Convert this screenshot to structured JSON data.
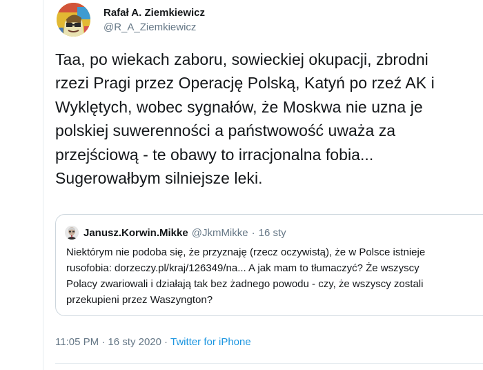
{
  "tweet": {
    "author": {
      "display_name": "Rafał A. Ziemkiewicz",
      "handle": "@R_A_Ziemkiewicz",
      "avatar_icon": "profile-avatar"
    },
    "text": "Taa, po wiekach zaboru, sowieckiej okupacji, zbrodni\nrzezi Pragi przez Operację Polską, Katyń po rzeź AK i\nWyklętych, wobec sygnałów, że Moskwa nie uzna je\npolskiej suwerenności a państwowość uważa za\nprzejściową - te obawy to irracjonalna fobia...\nSugerowałbym silniejsze leki.",
    "timestamp": "11:05 PM · 16 sty 2020",
    "separator": "·",
    "source": "Twitter for iPhone"
  },
  "quoted_tweet": {
    "display_name": "Janusz.Korwin.Mikke",
    "handle": "@JkmMikke",
    "separator": "·",
    "date": "16 sty",
    "avatar_icon": "profile-avatar",
    "text": "Niektórym nie podoba się, że przyznaję (rzecz oczywistą), że w Polsce istnieje\nrusofobia: dorzeczy.pl/kraj/126349/na... A jak mam to tłumaczyć? Że wszyscy\nPolacy zwariowali i działają tak bez żadnego powodu - czy, że wszyscy zostali\nprzekupieni przez Waszyngton?"
  },
  "colors": {
    "text_primary": "#14171a",
    "text_secondary": "#657786",
    "link": "#1b95e0",
    "border": "#ccd6dd"
  }
}
